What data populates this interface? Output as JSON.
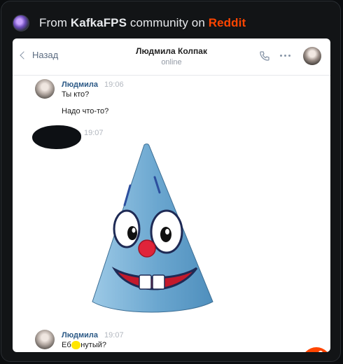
{
  "embed": {
    "prefix": "From",
    "subreddit": "KafkaFPS",
    "middle": "community on",
    "brand": "Reddit"
  },
  "chat": {
    "back_label": "Назад",
    "peer_name": "Людмила Колпак",
    "peer_status": "online",
    "messages": [
      {
        "author": "Людмила",
        "time": "19:06",
        "lines": [
          "Ты кто?",
          "Надо что-то?"
        ]
      },
      {
        "author": "",
        "time": "19:07",
        "lines": []
      },
      {
        "author": "Людмила",
        "time": "19:07",
        "lines": [
          "Еб",
          "нутый?"
        ]
      }
    ]
  },
  "colors": {
    "brand": "#ff4500",
    "vk_name": "#2a5885",
    "sticker_blue": "#6aa6cf",
    "highlight": "#ffe600"
  }
}
